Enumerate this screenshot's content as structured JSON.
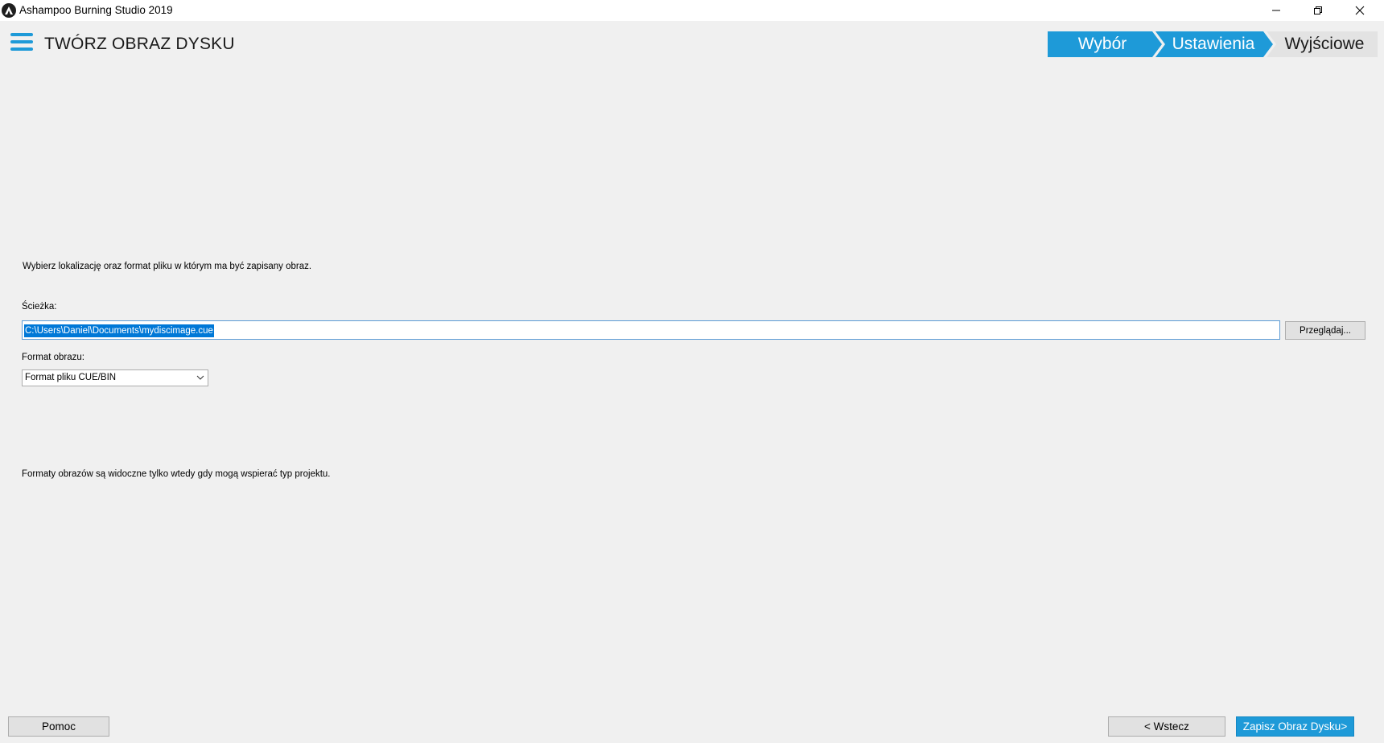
{
  "window": {
    "title": "Ashampoo Burning Studio 2019",
    "controls": [
      "minimize-icon",
      "restore-icon",
      "close-icon"
    ]
  },
  "header": {
    "title": "TWÓRZ OBRAZ DYSKU",
    "steps": [
      {
        "label": "Wybór",
        "state": "completed"
      },
      {
        "label": "Ustawienia",
        "state": "active"
      },
      {
        "label": "Wyjściowe",
        "state": "pending"
      }
    ]
  },
  "main": {
    "instruction": "Wybierz lokalizację oraz format pliku w którym ma być zapisany obraz.",
    "path_label": "Ścieżka:",
    "path_value": "C:\\Users\\Daniel\\Documents\\mydiscimage.cue",
    "browse_label": "Przeglądaj...",
    "format_label": "Format obrazu:",
    "format_value": "Format pliku CUE/BIN",
    "note": "Formaty obrazów są widoczne tylko wtedy gdy mogą wspierać typ projektu."
  },
  "footer": {
    "help_label": "Pomoc",
    "back_label": "< Wstecz",
    "save_label": "Zapisz Obraz Dysku>"
  },
  "colors": {
    "accent": "#1e9ad8",
    "background": "#f0f0f0",
    "selection": "#0078d7"
  }
}
